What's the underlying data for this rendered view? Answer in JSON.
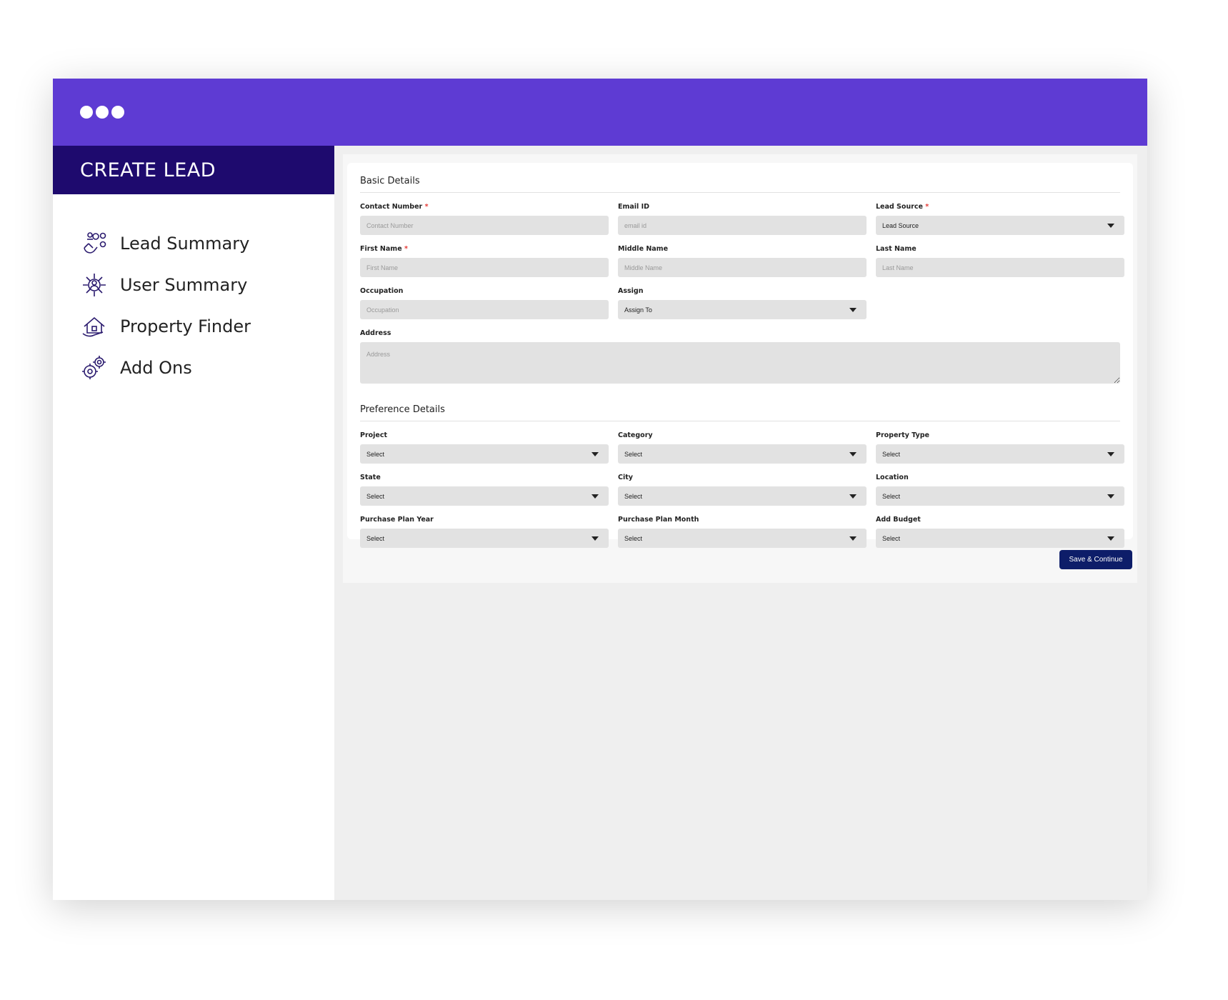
{
  "sidebar": {
    "title": "CREATE LEAD",
    "items": [
      {
        "label": "Lead Summary",
        "icon": "lead-summary-icon"
      },
      {
        "label": "User Summary",
        "icon": "user-summary-icon"
      },
      {
        "label": "Property Finder",
        "icon": "property-finder-icon"
      },
      {
        "label": "Add Ons",
        "icon": "add-ons-icon"
      }
    ]
  },
  "basic": {
    "title": "Basic Details",
    "contact_number": {
      "label": "Contact Number",
      "required": "*",
      "placeholder": "Contact Number"
    },
    "email": {
      "label": "Email ID",
      "placeholder": "email id"
    },
    "lead_source": {
      "label": "Lead Source",
      "required": "*",
      "value": "Lead Source"
    },
    "first_name": {
      "label": "First Name",
      "required": "*",
      "placeholder": "First Name"
    },
    "middle_name": {
      "label": "Middle Name",
      "placeholder": "Middle Name"
    },
    "last_name": {
      "label": "Last Name",
      "placeholder": "Last Name"
    },
    "occupation": {
      "label": "Occupation",
      "placeholder": "Occupation"
    },
    "assign": {
      "label": "Assign",
      "value": "Assign To"
    },
    "address": {
      "label": "Address",
      "placeholder": "Address"
    }
  },
  "preference": {
    "title": "Preference Details",
    "project": {
      "label": "Project",
      "value": "Select"
    },
    "category": {
      "label": "Category",
      "value": "Select"
    },
    "property_type": {
      "label": "Property Type",
      "value": "Select"
    },
    "state": {
      "label": "State",
      "value": "Select"
    },
    "city": {
      "label": "City",
      "value": "Select"
    },
    "location": {
      "label": "Location",
      "value": "Select"
    },
    "purchase_year": {
      "label": "Purchase Plan Year",
      "value": "Select"
    },
    "purchase_month": {
      "label": "Purchase Plan Month",
      "value": "Select"
    },
    "budget": {
      "label": "Add Budget",
      "value": "Select"
    }
  },
  "actions": {
    "save_label": "Save & Continue"
  },
  "colors": {
    "header": "#5e3bd3",
    "sidebar_title": "#1e0a6e",
    "button": "#0d1d69"
  }
}
